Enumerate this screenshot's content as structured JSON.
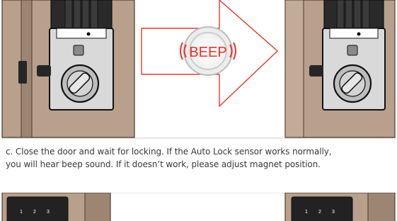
{
  "figure_top": {
    "beep_label": "BEEP",
    "colors": {
      "beep_red": "#e8332a",
      "arrow_outline": "#e23a2c",
      "wall": "#b8a08c",
      "door_edge": "#7a6452",
      "lock_body": "#262626",
      "thumbturn": "#bdbdbd"
    }
  },
  "caption": {
    "line1": "c. Close the door and wait for locking. If the Auto Lock sensor works normally,",
    "line2": "you will hear beep sound. If it doesn’t work, please adjust magnet position."
  },
  "figure_bottom": {
    "keypad_left": [
      "1",
      "2",
      "3"
    ],
    "keypad_right": [
      "1",
      "2",
      "3"
    ]
  }
}
